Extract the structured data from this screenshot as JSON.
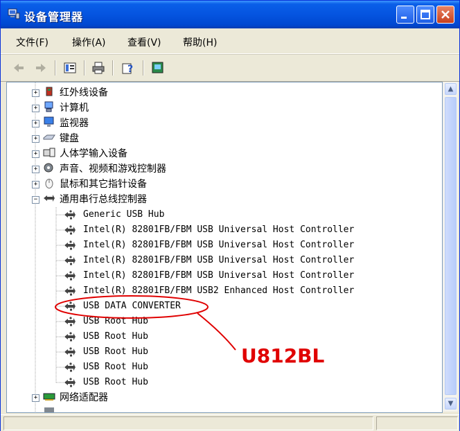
{
  "window": {
    "title": "设备管理器"
  },
  "menus": [
    "文件(F)",
    "操作(A)",
    "查看(V)",
    "帮助(H)"
  ],
  "toolbar": {
    "back_icon": "back-arrow-icon",
    "forward_icon": "forward-arrow-icon",
    "properties_icon": "properties-icon",
    "print_icon": "printer-icon",
    "help_icon": "help-icon",
    "scan_icon": "scan-hardware-icon"
  },
  "tree": {
    "categories_top": [
      {
        "label": "红外线设备",
        "icon": "infrared-icon"
      },
      {
        "label": "计算机",
        "icon": "computer-icon"
      },
      {
        "label": "监视器",
        "icon": "monitor-icon"
      },
      {
        "label": "键盘",
        "icon": "keyboard-icon"
      },
      {
        "label": "人体学输入设备",
        "icon": "hid-icon"
      },
      {
        "label": "声音、视频和游戏控制器",
        "icon": "sound-icon"
      },
      {
        "label": "鼠标和其它指针设备",
        "icon": "mouse-icon"
      }
    ],
    "usb_category": {
      "label": "通用串行总线控制器",
      "icon": "usb-icon"
    },
    "usb_children": [
      "Generic USB Hub",
      "Intel(R) 82801FB/FBM USB Universal Host Controller",
      "Intel(R) 82801FB/FBM USB Universal Host Controller",
      "Intel(R) 82801FB/FBM USB Universal Host Controller",
      "Intel(R) 82801FB/FBM USB Universal Host Controller",
      "Intel(R) 82801FB/FBM USB2 Enhanced Host Controller",
      "USB DATA CONVERTER",
      "USB Root Hub",
      "USB Root Hub",
      "USB Root Hub",
      "USB Root Hub",
      "USB Root Hub"
    ],
    "categories_bottom": [
      {
        "label": "网络适配器",
        "icon": "network-adapter-icon"
      }
    ]
  },
  "annotation": {
    "label": "U812BL",
    "color": "#e00000"
  },
  "colors": {
    "title_bar": "#0554e0",
    "annotation": "#e00000"
  }
}
